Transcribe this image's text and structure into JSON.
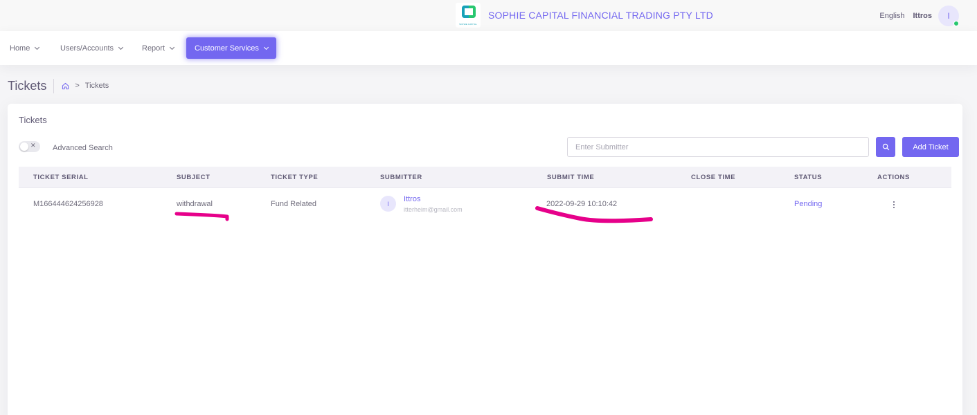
{
  "header": {
    "logo_text": "SOPHIE CAPITAL",
    "company_name": "SOPHIE CAPITAL FINANCIAL TRADING PTY LTD",
    "language": "English",
    "username": "Ittros",
    "avatar_initial": "I"
  },
  "nav": {
    "items": [
      {
        "label": "Home"
      },
      {
        "label": "Users/Accounts"
      },
      {
        "label": "Report"
      },
      {
        "label": "Customer Services",
        "active": true
      }
    ]
  },
  "page": {
    "title": "Tickets",
    "breadcrumb": [
      "Tickets"
    ]
  },
  "card": {
    "title": "Tickets",
    "advanced_search_label": "Advanced Search",
    "search_placeholder": "Enter Submitter",
    "add_button_label": "Add Ticket"
  },
  "table": {
    "columns": [
      "Ticket Serial",
      "Subject",
      "Ticket Type",
      "Submitter",
      "Submit Time",
      "Close Time",
      "Status",
      "Actions"
    ],
    "rows": [
      {
        "serial": "M166444624256928",
        "subject": "withdrawal",
        "type": "Fund Related",
        "submitter_initial": "I",
        "submitter_name": "Ittros",
        "submitter_email": "itterheim@gmail.com",
        "submit_time": "2022-09-29 10:10:42",
        "close_time": "",
        "status": "Pending"
      }
    ]
  },
  "colors": {
    "primary": "#7367f0",
    "online": "#28c76f",
    "annotation": "#e6008a"
  },
  "icons": [
    "home-icon",
    "chevron-down-icon",
    "search-icon",
    "more-vertical-icon",
    "close-icon"
  ]
}
